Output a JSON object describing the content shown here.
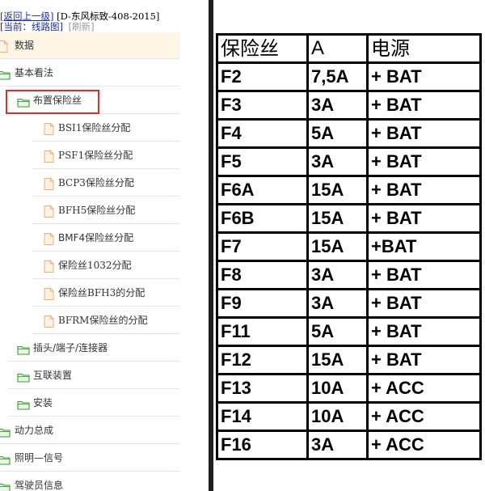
{
  "header": {
    "back_link": "[返回上一级]",
    "doc_title": "[D-东风标致-408-2015]",
    "current": "[当前：线路图]",
    "refresh": "[刷新]"
  },
  "tree": [
    {
      "label": "数据",
      "icon": "file-icon",
      "selected": true
    },
    {
      "label": "基本看法",
      "icon": "folder-icon"
    },
    {
      "label": "布置保险丝",
      "icon": "folder-icon",
      "highlighted": true
    },
    {
      "label": "BSI1保险丝分配",
      "icon": "file-icon"
    },
    {
      "label": "PSF1保险丝分配",
      "icon": "file-icon"
    },
    {
      "label": "BCP3保险丝分配",
      "icon": "file-icon"
    },
    {
      "label": "BFH5保险丝分配",
      "icon": "file-icon"
    },
    {
      "label": "BMF4保险丝分配",
      "icon": "file-icon"
    },
    {
      "label": "保险丝1032分配",
      "icon": "file-icon"
    },
    {
      "label": "保险丝BFH3的分配",
      "icon": "file-icon"
    },
    {
      "label": "BFRM保险丝的分配",
      "icon": "file-icon"
    },
    {
      "label": "插头/端子/连接器",
      "icon": "folder-icon"
    },
    {
      "label": "互联装置",
      "icon": "folder-icon"
    },
    {
      "label": "安装",
      "icon": "folder-icon"
    },
    {
      "label": "动力总成",
      "icon": "folder-icon"
    },
    {
      "label": "照明—信号",
      "icon": "folder-icon"
    },
    {
      "label": "驾驶员信息",
      "icon": "folder-icon"
    }
  ],
  "table": {
    "headers": [
      "保险丝",
      "A",
      "电源"
    ],
    "rows": [
      [
        "F2",
        "7,5A",
        "+ BAT"
      ],
      [
        "F3",
        "3A",
        "+ BAT"
      ],
      [
        "F4",
        "5A",
        "+ BAT"
      ],
      [
        "F5",
        "3A",
        "+ BAT"
      ],
      [
        "F6A",
        "15A",
        "+ BAT"
      ],
      [
        "F6B",
        "15A",
        "+ BAT"
      ],
      [
        "F7",
        "15A",
        "+BAT"
      ],
      [
        "F8",
        "3A",
        "+ BAT"
      ],
      [
        "F9",
        "3A",
        "+ BAT"
      ],
      [
        "F11",
        "5A",
        "+ BAT"
      ],
      [
        "F12",
        "15A",
        "+ BAT"
      ],
      [
        "F13",
        "10A",
        "+ ACC"
      ],
      [
        "F14",
        "10A",
        "+ ACC"
      ],
      [
        "F16",
        "3A",
        "+ ACC"
      ]
    ]
  },
  "colors": {
    "link": "#1a2fb0",
    "selected_bg": "#fdf5e6",
    "highlight_box": "#d9302c",
    "folder_icon": "#3a9a3a",
    "file_icon": "#e7b07a"
  }
}
